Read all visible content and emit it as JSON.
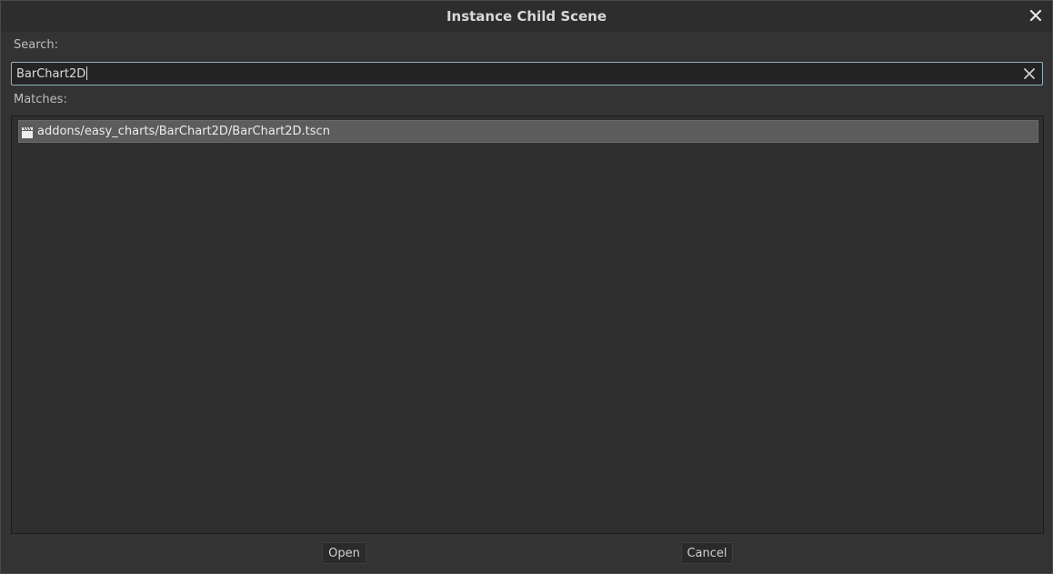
{
  "dialog": {
    "title": "Instance Child Scene",
    "close_icon": "close-icon"
  },
  "search": {
    "label": "Search:",
    "value": "BarChart2D",
    "clear_icon": "clear-icon"
  },
  "matches": {
    "label": "Matches:",
    "items": [
      {
        "icon": "scene-clapperboard-icon",
        "path": "addons/easy_charts/BarChart2D/BarChart2D.tscn",
        "selected": true
      }
    ]
  },
  "buttons": {
    "open": "Open",
    "cancel": "Cancel"
  }
}
